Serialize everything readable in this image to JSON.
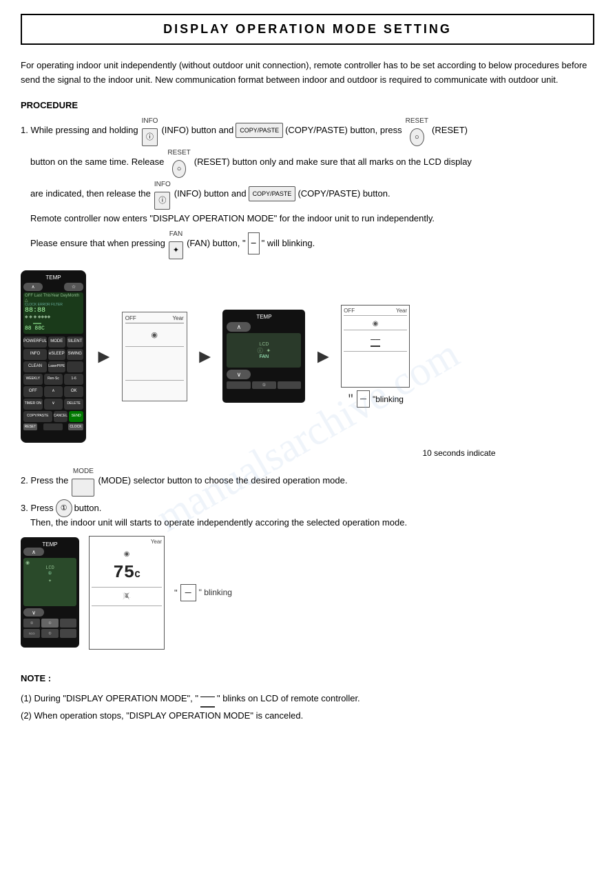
{
  "title": "DISPLAY OPERATION MODE SETTING",
  "intro": {
    "paragraph": "For operating indoor unit independently (without outdoor unit connection), remote controller has to be set according to below procedures before send the signal to the indoor unit. New communication format between indoor and outdoor is required to communicate with outdoor unit."
  },
  "procedure": {
    "heading": "PROCEDURE",
    "step1": {
      "line1a": "1. While pressing and holding",
      "btn_info_label": "INFO",
      "line1b": "(INFO) button and",
      "btn_copypaste_label": "COPY/PASTE",
      "line1c": "(COPY/PASTE) button, press",
      "btn_reset_label": "RESET",
      "line1d": "(RESET)",
      "line2a": "button on the same time. Release",
      "line2b": "(RESET) button only and make sure that all marks on the LCD display",
      "line3a": "are indicated, then release the",
      "line3b": "(INFO) button and",
      "line3c": "(COPY/PASTE) button.",
      "line4": "Remote controller now enters \"DISPLAY OPERATION MODE\" for the indoor unit to run independently.",
      "line5a": "Please ensure that when pressing",
      "btn_fan_label": "FAN",
      "line5b": "(FAN) button, \"",
      "line5c": "\" will blinking."
    },
    "indicator_label": "10 seconds indicate",
    "blink_label": "\"blinking",
    "step2": {
      "text1": "2. Press the",
      "btn_mode_label": "MODE",
      "text2": "(MODE) selector button to choose the desired operation mode."
    },
    "step3": {
      "text1": "3. Press",
      "btn_start_label": "START/STOP",
      "text2": "button.",
      "text3": "Then, the indoor unit will starts to operate independently accoring the selected operation mode."
    },
    "blink2_label": "\" blinking"
  },
  "note": {
    "heading": "NOTE :",
    "line1": "(1) During \"DISPLAY OPERATION MODE\", \"     \" blinks on LCD of remote controller.",
    "line2": "(2) When operation stops, \"DISPLAY OPERATION MODE\" is canceled."
  },
  "watermark": "manualsarchive.com"
}
